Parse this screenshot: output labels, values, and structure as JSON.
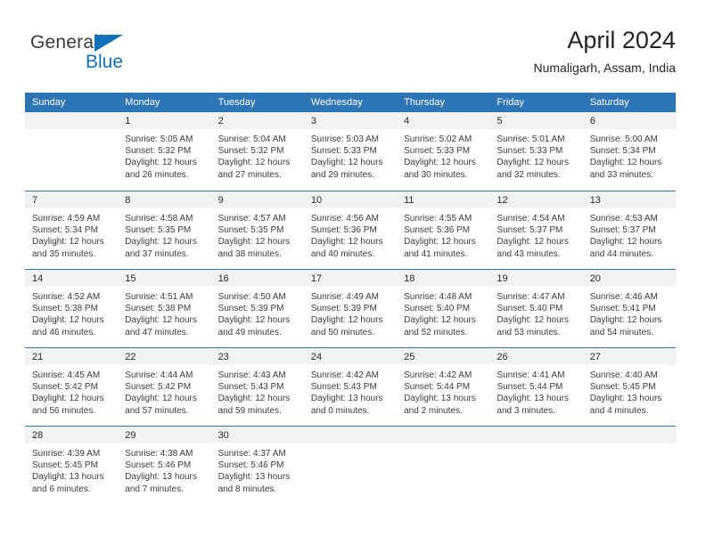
{
  "logo": {
    "word_one": "General",
    "word_two": "Blue",
    "triangle_icon": "triangle-icon",
    "accent_color": "#1270b8"
  },
  "header": {
    "title": "April 2024",
    "subtitle": "Numaligarh, Assam, India"
  },
  "colors": {
    "header_bg": "#2e75b6",
    "header_text": "#ffffff",
    "daynum_band": "#f2f2f2",
    "row_border": "#2e75b6"
  },
  "calendar": {
    "weekday_headers": [
      "Sunday",
      "Monday",
      "Tuesday",
      "Wednesday",
      "Thursday",
      "Friday",
      "Saturday"
    ],
    "weeks": [
      [
        {
          "day": "",
          "sunrise": "",
          "sunset": "",
          "daylight_line1": "",
          "daylight_line2": ""
        },
        {
          "day": "1",
          "sunrise": "Sunrise: 5:05 AM",
          "sunset": "Sunset: 5:32 PM",
          "daylight_line1": "Daylight: 12 hours",
          "daylight_line2": "and 26 minutes."
        },
        {
          "day": "2",
          "sunrise": "Sunrise: 5:04 AM",
          "sunset": "Sunset: 5:32 PM",
          "daylight_line1": "Daylight: 12 hours",
          "daylight_line2": "and 27 minutes."
        },
        {
          "day": "3",
          "sunrise": "Sunrise: 5:03 AM",
          "sunset": "Sunset: 5:33 PM",
          "daylight_line1": "Daylight: 12 hours",
          "daylight_line2": "and 29 minutes."
        },
        {
          "day": "4",
          "sunrise": "Sunrise: 5:02 AM",
          "sunset": "Sunset: 5:33 PM",
          "daylight_line1": "Daylight: 12 hours",
          "daylight_line2": "and 30 minutes."
        },
        {
          "day": "5",
          "sunrise": "Sunrise: 5:01 AM",
          "sunset": "Sunset: 5:33 PM",
          "daylight_line1": "Daylight: 12 hours",
          "daylight_line2": "and 32 minutes."
        },
        {
          "day": "6",
          "sunrise": "Sunrise: 5:00 AM",
          "sunset": "Sunset: 5:34 PM",
          "daylight_line1": "Daylight: 12 hours",
          "daylight_line2": "and 33 minutes."
        }
      ],
      [
        {
          "day": "7",
          "sunrise": "Sunrise: 4:59 AM",
          "sunset": "Sunset: 5:34 PM",
          "daylight_line1": "Daylight: 12 hours",
          "daylight_line2": "and 35 minutes."
        },
        {
          "day": "8",
          "sunrise": "Sunrise: 4:58 AM",
          "sunset": "Sunset: 5:35 PM",
          "daylight_line1": "Daylight: 12 hours",
          "daylight_line2": "and 37 minutes."
        },
        {
          "day": "9",
          "sunrise": "Sunrise: 4:57 AM",
          "sunset": "Sunset: 5:35 PM",
          "daylight_line1": "Daylight: 12 hours",
          "daylight_line2": "and 38 minutes."
        },
        {
          "day": "10",
          "sunrise": "Sunrise: 4:56 AM",
          "sunset": "Sunset: 5:36 PM",
          "daylight_line1": "Daylight: 12 hours",
          "daylight_line2": "and 40 minutes."
        },
        {
          "day": "11",
          "sunrise": "Sunrise: 4:55 AM",
          "sunset": "Sunset: 5:36 PM",
          "daylight_line1": "Daylight: 12 hours",
          "daylight_line2": "and 41 minutes."
        },
        {
          "day": "12",
          "sunrise": "Sunrise: 4:54 AM",
          "sunset": "Sunset: 5:37 PM",
          "daylight_line1": "Daylight: 12 hours",
          "daylight_line2": "and 43 minutes."
        },
        {
          "day": "13",
          "sunrise": "Sunrise: 4:53 AM",
          "sunset": "Sunset: 5:37 PM",
          "daylight_line1": "Daylight: 12 hours",
          "daylight_line2": "and 44 minutes."
        }
      ],
      [
        {
          "day": "14",
          "sunrise": "Sunrise: 4:52 AM",
          "sunset": "Sunset: 5:38 PM",
          "daylight_line1": "Daylight: 12 hours",
          "daylight_line2": "and 46 minutes."
        },
        {
          "day": "15",
          "sunrise": "Sunrise: 4:51 AM",
          "sunset": "Sunset: 5:38 PM",
          "daylight_line1": "Daylight: 12 hours",
          "daylight_line2": "and 47 minutes."
        },
        {
          "day": "16",
          "sunrise": "Sunrise: 4:50 AM",
          "sunset": "Sunset: 5:39 PM",
          "daylight_line1": "Daylight: 12 hours",
          "daylight_line2": "and 49 minutes."
        },
        {
          "day": "17",
          "sunrise": "Sunrise: 4:49 AM",
          "sunset": "Sunset: 5:39 PM",
          "daylight_line1": "Daylight: 12 hours",
          "daylight_line2": "and 50 minutes."
        },
        {
          "day": "18",
          "sunrise": "Sunrise: 4:48 AM",
          "sunset": "Sunset: 5:40 PM",
          "daylight_line1": "Daylight: 12 hours",
          "daylight_line2": "and 52 minutes."
        },
        {
          "day": "19",
          "sunrise": "Sunrise: 4:47 AM",
          "sunset": "Sunset: 5:40 PM",
          "daylight_line1": "Daylight: 12 hours",
          "daylight_line2": "and 53 minutes."
        },
        {
          "day": "20",
          "sunrise": "Sunrise: 4:46 AM",
          "sunset": "Sunset: 5:41 PM",
          "daylight_line1": "Daylight: 12 hours",
          "daylight_line2": "and 54 minutes."
        }
      ],
      [
        {
          "day": "21",
          "sunrise": "Sunrise: 4:45 AM",
          "sunset": "Sunset: 5:42 PM",
          "daylight_line1": "Daylight: 12 hours",
          "daylight_line2": "and 56 minutes."
        },
        {
          "day": "22",
          "sunrise": "Sunrise: 4:44 AM",
          "sunset": "Sunset: 5:42 PM",
          "daylight_line1": "Daylight: 12 hours",
          "daylight_line2": "and 57 minutes."
        },
        {
          "day": "23",
          "sunrise": "Sunrise: 4:43 AM",
          "sunset": "Sunset: 5:43 PM",
          "daylight_line1": "Daylight: 12 hours",
          "daylight_line2": "and 59 minutes."
        },
        {
          "day": "24",
          "sunrise": "Sunrise: 4:42 AM",
          "sunset": "Sunset: 5:43 PM",
          "daylight_line1": "Daylight: 13 hours",
          "daylight_line2": "and 0 minutes."
        },
        {
          "day": "25",
          "sunrise": "Sunrise: 4:42 AM",
          "sunset": "Sunset: 5:44 PM",
          "daylight_line1": "Daylight: 13 hours",
          "daylight_line2": "and 2 minutes."
        },
        {
          "day": "26",
          "sunrise": "Sunrise: 4:41 AM",
          "sunset": "Sunset: 5:44 PM",
          "daylight_line1": "Daylight: 13 hours",
          "daylight_line2": "and 3 minutes."
        },
        {
          "day": "27",
          "sunrise": "Sunrise: 4:40 AM",
          "sunset": "Sunset: 5:45 PM",
          "daylight_line1": "Daylight: 13 hours",
          "daylight_line2": "and 4 minutes."
        }
      ],
      [
        {
          "day": "28",
          "sunrise": "Sunrise: 4:39 AM",
          "sunset": "Sunset: 5:45 PM",
          "daylight_line1": "Daylight: 13 hours",
          "daylight_line2": "and 6 minutes."
        },
        {
          "day": "29",
          "sunrise": "Sunrise: 4:38 AM",
          "sunset": "Sunset: 5:46 PM",
          "daylight_line1": "Daylight: 13 hours",
          "daylight_line2": "and 7 minutes."
        },
        {
          "day": "30",
          "sunrise": "Sunrise: 4:37 AM",
          "sunset": "Sunset: 5:46 PM",
          "daylight_line1": "Daylight: 13 hours",
          "daylight_line2": "and 8 minutes."
        },
        {
          "day": "",
          "sunrise": "",
          "sunset": "",
          "daylight_line1": "",
          "daylight_line2": ""
        },
        {
          "day": "",
          "sunrise": "",
          "sunset": "",
          "daylight_line1": "",
          "daylight_line2": ""
        },
        {
          "day": "",
          "sunrise": "",
          "sunset": "",
          "daylight_line1": "",
          "daylight_line2": ""
        },
        {
          "day": "",
          "sunrise": "",
          "sunset": "",
          "daylight_line1": "",
          "daylight_line2": ""
        }
      ]
    ]
  }
}
